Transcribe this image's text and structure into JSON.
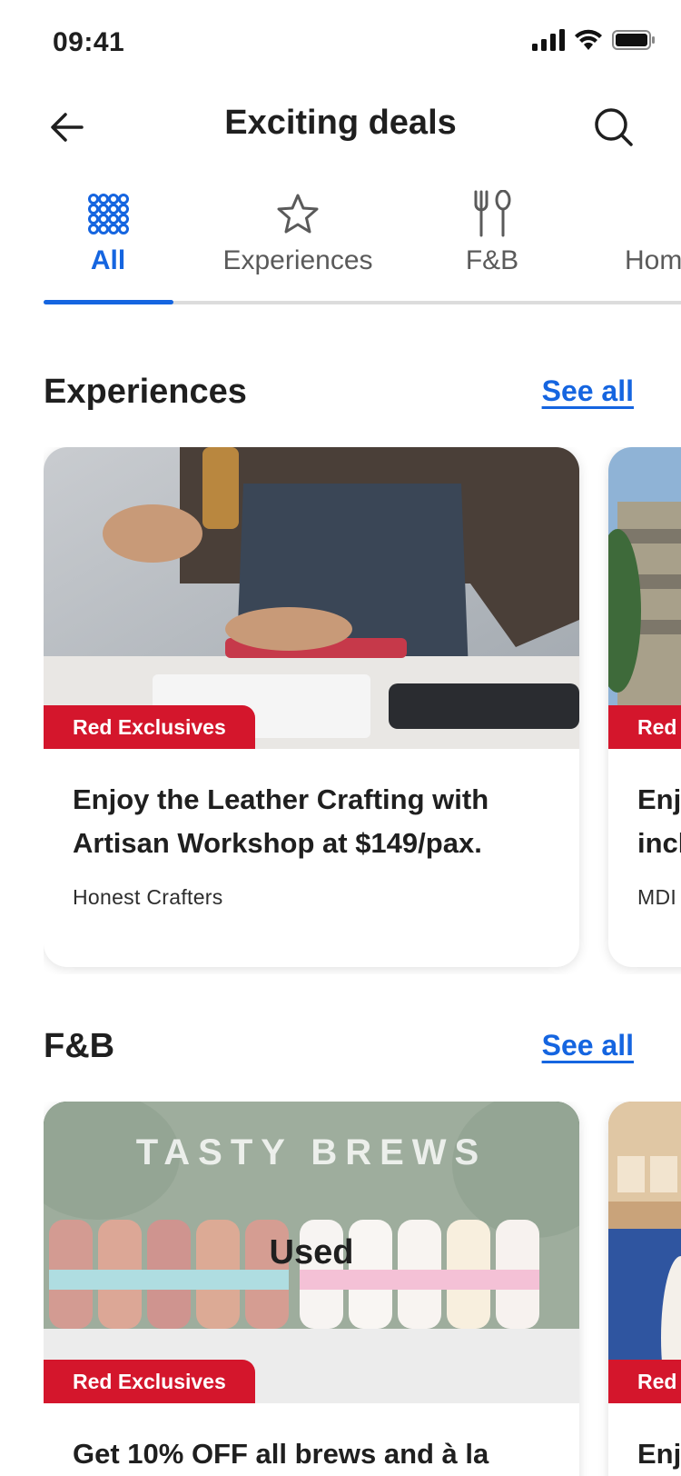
{
  "status": {
    "time": "09:41"
  },
  "header": {
    "title": "Exciting deals"
  },
  "tabs": [
    {
      "label": "All",
      "icon": "grid-dots-icon",
      "active": true
    },
    {
      "label": "Experiences",
      "icon": "star-outline-icon",
      "active": false
    },
    {
      "label": "F&B",
      "icon": "fork-spoon-icon",
      "active": false
    },
    {
      "label": "Home",
      "icon": "home-icon",
      "active": false
    }
  ],
  "sections": [
    {
      "title": "Experiences",
      "see_all": "See all",
      "cards": [
        {
          "badge": "Red Exclusives",
          "title": "Enjoy the Leather Crafting with Artisan Workshop at $149/pax.",
          "merchant": "Honest Crafters",
          "used": false
        },
        {
          "badge": "Red",
          "title": "Enj incl",
          "merchant": "MDI",
          "used": false
        }
      ]
    },
    {
      "title": "F&B",
      "see_all": "See all",
      "cards": [
        {
          "badge": "Red Exclusives",
          "title": "Get 10% OFF all brews and à la",
          "image_text": "TASTY BREWS",
          "used_label": "Used",
          "used": true
        },
        {
          "badge": "Red",
          "title": "Enj",
          "used": false
        }
      ]
    }
  ],
  "colors": {
    "accent": "#1565e0",
    "badge": "#d4162c",
    "text": "#1f1f1f"
  }
}
